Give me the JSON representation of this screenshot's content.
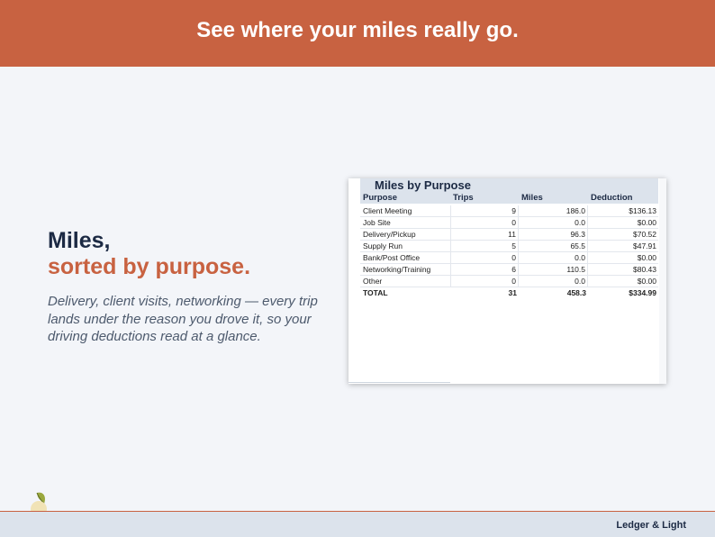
{
  "banner": {
    "title": "See where your miles really go."
  },
  "headline": {
    "line1": "Miles,",
    "line2": "sorted by purpose.",
    "description": "Delivery, client visits, networking — every trip lands under the reason you drove it, so your driving deductions read at a glance."
  },
  "sheet": {
    "title": "Miles by Purpose",
    "columns": [
      "Purpose",
      "Trips",
      "Miles",
      "Deduction"
    ],
    "rows": [
      [
        "Client Meeting",
        "9",
        "186.0",
        "$136.13"
      ],
      [
        "Job Site",
        "0",
        "0.0",
        "$0.00"
      ],
      [
        "Delivery/Pickup",
        "11",
        "96.3",
        "$70.52"
      ],
      [
        "Supply Run",
        "5",
        "65.5",
        "$47.91"
      ],
      [
        "Bank/Post Office",
        "0",
        "0.0",
        "$0.00"
      ],
      [
        "Networking/Training",
        "6",
        "110.5",
        "$80.43"
      ],
      [
        "Other",
        "0",
        "0.0",
        "$0.00"
      ],
      [
        "TOTAL",
        "31",
        "458.3",
        "$334.99"
      ]
    ]
  },
  "footer": {
    "brand": "Ledger & Light"
  },
  "colors": {
    "accent": "#c86241",
    "navy": "#1c2a44",
    "background": "#f3f5f9",
    "footer": "#dce3ec"
  },
  "icons": {
    "logo": "book-with-leaf-icon"
  }
}
